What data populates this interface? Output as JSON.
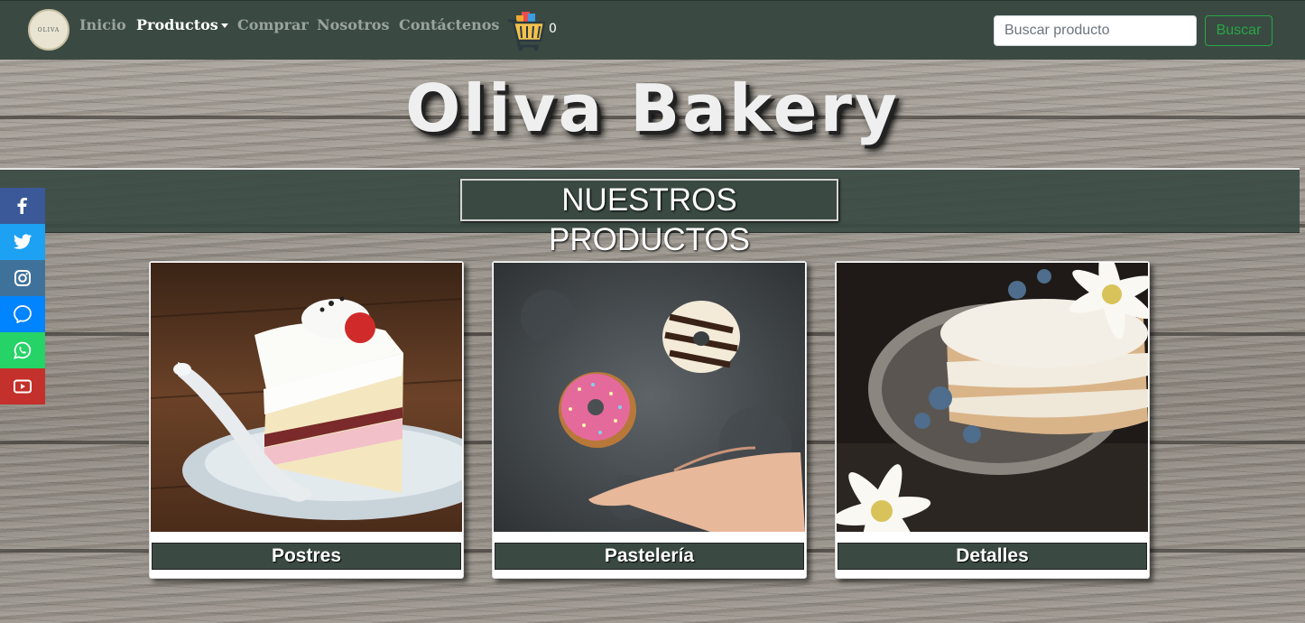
{
  "nav": {
    "logo_text": "OLIVA",
    "links": [
      "Inicio",
      "Productos",
      "Comprar",
      "Nosotros",
      "Contáctenos"
    ],
    "cart_count": "0",
    "search_placeholder": "Buscar producto",
    "search_button": "Buscar"
  },
  "hero": {
    "title": "Oliva Bakery"
  },
  "section": {
    "title": "NUESTROS PRODUCTOS"
  },
  "social": [
    "facebook-icon",
    "twitter-icon",
    "instagram-icon",
    "messenger-icon",
    "whatsapp-icon",
    "youtube-icon"
  ],
  "cards": [
    {
      "caption": "Postres"
    },
    {
      "caption": "Pastelería"
    },
    {
      "caption": "Detalles"
    }
  ],
  "colors": {
    "navbar": "#3a4a43",
    "accent": "#28a745"
  }
}
